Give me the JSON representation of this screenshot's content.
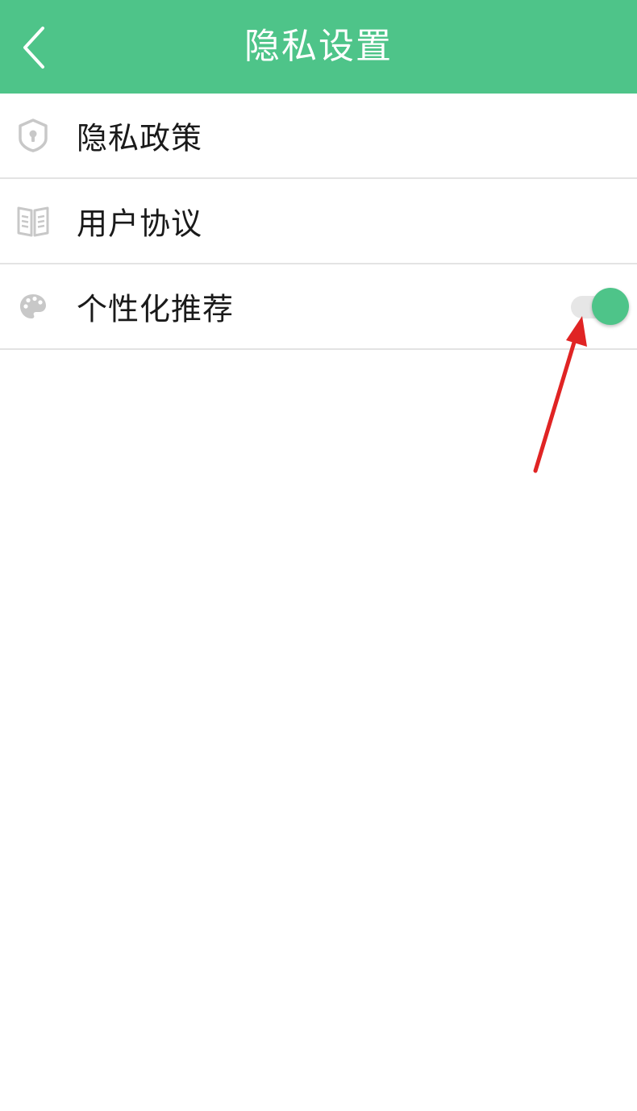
{
  "header": {
    "title": "隐私设置",
    "back_icon": "chevron-left-icon",
    "background_color": "#4ec489"
  },
  "settings": {
    "items": [
      {
        "label": "隐私政策",
        "icon": "shield-lock-icon"
      },
      {
        "label": "用户协议",
        "icon": "book-icon"
      },
      {
        "label": "个性化推荐",
        "icon": "palette-icon",
        "toggle": {
          "on": true,
          "color": "#4ec489"
        }
      }
    ]
  },
  "annotation": {
    "arrow_color": "#e02424",
    "target": "personalized-recommendation-toggle"
  }
}
